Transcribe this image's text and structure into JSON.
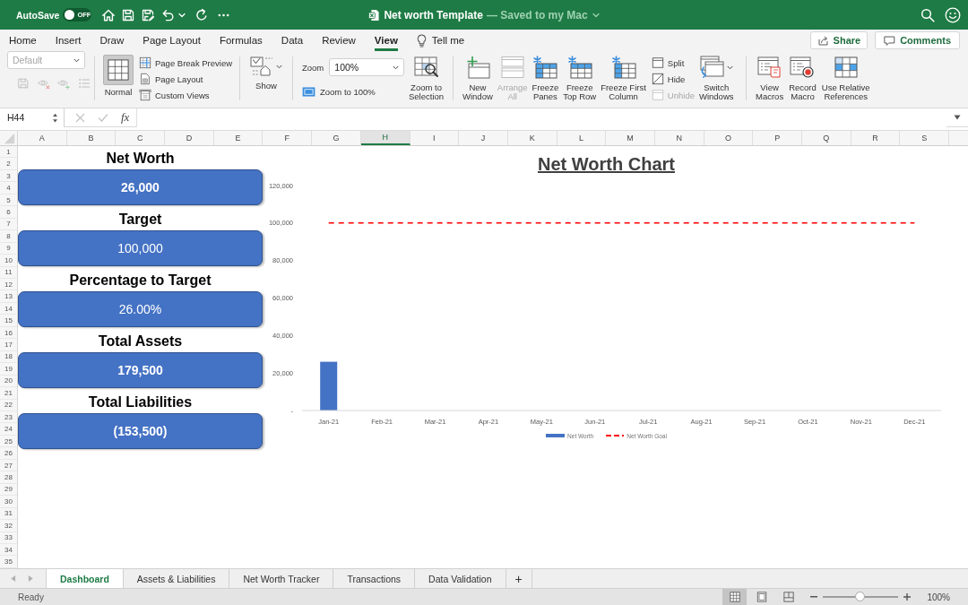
{
  "title_bar": {
    "autosave_label": "AutoSave",
    "autosave": {
      "on": false,
      "text": "OFF"
    },
    "file_name": "Net worth Template",
    "save_status": "— Saved to my Mac"
  },
  "menu_tabs": [
    {
      "label": "Home",
      "selected": false
    },
    {
      "label": "Insert",
      "selected": false
    },
    {
      "label": "Draw",
      "selected": false
    },
    {
      "label": "Page Layout",
      "selected": false
    },
    {
      "label": "Formulas",
      "selected": false
    },
    {
      "label": "Data",
      "selected": false
    },
    {
      "label": "Review",
      "selected": false
    },
    {
      "label": "View",
      "selected": true
    }
  ],
  "tell_me": "Tell me",
  "share_button": "Share",
  "comments_button": "Comments",
  "ribbon": {
    "sheet_view": {
      "value": "Default",
      "disabled": true
    },
    "sheet_view_tools": [
      {
        "kind": "keep",
        "disabled": true
      },
      {
        "kind": "exit",
        "disabled": true
      },
      {
        "kind": "new",
        "disabled": true
      },
      {
        "kind": "options",
        "disabled": true
      }
    ],
    "workbook_views": [
      {
        "kind": "normal",
        "label": "Normal",
        "selected": true
      },
      {
        "kind": "page-break",
        "label": "Page Break Preview",
        "selected": false
      },
      {
        "kind": "page-layout",
        "label": "Page Layout",
        "selected": false
      }
    ],
    "custom_views": "Custom Views",
    "show": "Show",
    "zoom_label": "Zoom",
    "zoom_value": "100%",
    "zoom_to_100": "Zoom to 100%",
    "zoom_to_selection": "Zoom to\nSelection",
    "window_buttons": [
      {
        "kind": "new-window",
        "label": "New\nWindow",
        "disabled": false
      },
      {
        "kind": "arrange",
        "label": "Arrange\nAll",
        "disabled": true
      },
      {
        "kind": "freeze-panes",
        "label": "Freeze\nPanes",
        "disabled": false
      },
      {
        "kind": "freeze-top-row",
        "label": "Freeze\nTop Row",
        "disabled": false
      },
      {
        "kind": "freeze-first-column",
        "label": "Freeze First\nColumn",
        "disabled": false
      }
    ],
    "window_toggles": [
      {
        "kind": "split",
        "label": "Split",
        "disabled": false
      },
      {
        "kind": "hide",
        "label": "Hide",
        "disabled": false
      },
      {
        "kind": "unhide",
        "label": "Unhide",
        "disabled": true
      }
    ],
    "switch_windows": "Switch\nWindows",
    "macro_buttons": [
      {
        "kind": "view-macros",
        "label": "View\nMacros"
      },
      {
        "kind": "record",
        "label": "Record\nMacro"
      },
      {
        "kind": "relative",
        "label": "Use Relative\nReferences"
      }
    ]
  },
  "formula_bar": {
    "name_box": "H44",
    "function_symbol": "fx"
  },
  "sheet": {
    "columns": [
      {
        "label": "A",
        "selected": false
      },
      {
        "label": "B",
        "selected": false
      },
      {
        "label": "C",
        "selected": false
      },
      {
        "label": "D",
        "selected": false
      },
      {
        "label": "E",
        "selected": false
      },
      {
        "label": "F",
        "selected": false
      },
      {
        "label": "G",
        "selected": false
      },
      {
        "label": "H",
        "selected": true
      },
      {
        "label": "I",
        "selected": false
      },
      {
        "label": "J",
        "selected": false
      },
      {
        "label": "K",
        "selected": false
      },
      {
        "label": "L",
        "selected": false
      },
      {
        "label": "M",
        "selected": false
      },
      {
        "label": "N",
        "selected": false
      },
      {
        "label": "O",
        "selected": false
      },
      {
        "label": "P",
        "selected": false
      },
      {
        "label": "Q",
        "selected": false
      },
      {
        "label": "R",
        "selected": false
      },
      {
        "label": "S",
        "selected": false
      }
    ],
    "rows": [
      "1",
      "2",
      "3",
      "4",
      "5",
      "6",
      "7",
      "8",
      "9",
      "10",
      "11",
      "12",
      "13",
      "14",
      "15",
      "16",
      "17",
      "18",
      "19",
      "20",
      "21",
      "22",
      "23",
      "24",
      "25",
      "26",
      "27",
      "28",
      "29",
      "30",
      "31",
      "32",
      "33",
      "34",
      "35"
    ]
  },
  "dashboard": {
    "cards": [
      {
        "title": "Net Worth",
        "value": "26,000",
        "bold": true
      },
      {
        "title": "Target",
        "value": "100,000",
        "bold": false
      },
      {
        "title": "Percentage to Target",
        "value": "26.00%",
        "bold": false
      },
      {
        "title": "Total Assets",
        "value": "179,500",
        "bold": true
      },
      {
        "title": "Total Liabilities",
        "value": "(153,500)",
        "bold": true
      }
    ]
  },
  "chart": {
    "chart_data": {
      "type": "bar",
      "title": "Net Worth Chart",
      "categories": [
        "Jan-21",
        "Feb-21",
        "Mar-21",
        "Apr-21",
        "May-21",
        "Jun-21",
        "Jul-21",
        "Aug-21",
        "Sep-21",
        "Oct-21",
        "Nov-21",
        "Dec-21"
      ],
      "series": [
        {
          "name": "Net Worth",
          "type": "bar",
          "color": "#4472c4",
          "values": [
            26000,
            null,
            null,
            null,
            null,
            null,
            null,
            null,
            null,
            null,
            null,
            null
          ]
        },
        {
          "name": "Net Worth Goal",
          "type": "line",
          "line_style": "dashed",
          "color": "#ff0000",
          "values": [
            100000,
            100000,
            100000,
            100000,
            100000,
            100000,
            100000,
            100000,
            100000,
            100000,
            100000,
            100000
          ]
        }
      ],
      "ylim": [
        0,
        120000
      ],
      "yticks": [
        {
          "value": 0,
          "label": "-"
        },
        {
          "value": 20000,
          "label": "20,000"
        },
        {
          "value": 40000,
          "label": "40,000"
        },
        {
          "value": 60000,
          "label": "60,000"
        },
        {
          "value": 80000,
          "label": "80,000"
        },
        {
          "value": 100000,
          "label": "100,000"
        },
        {
          "value": 120000,
          "label": "120,000"
        }
      ],
      "legend": "bottom"
    }
  },
  "sheet_tabs": [
    {
      "label": "Dashboard",
      "selected": true
    },
    {
      "label": "Assets & Liabilities",
      "selected": false
    },
    {
      "label": "Net Worth Tracker",
      "selected": false
    },
    {
      "label": "Transactions",
      "selected": false
    },
    {
      "label": "Data Validation",
      "selected": false
    }
  ],
  "add_sheet": "+",
  "status_bar": {
    "status": "Ready",
    "views": [
      {
        "kind": "normal",
        "selected": true
      },
      {
        "kind": "page-layout",
        "selected": false
      },
      {
        "kind": "page-break",
        "selected": false
      }
    ],
    "zoom_slider": {
      "level": 0.5
    },
    "zoom": "100%"
  }
}
